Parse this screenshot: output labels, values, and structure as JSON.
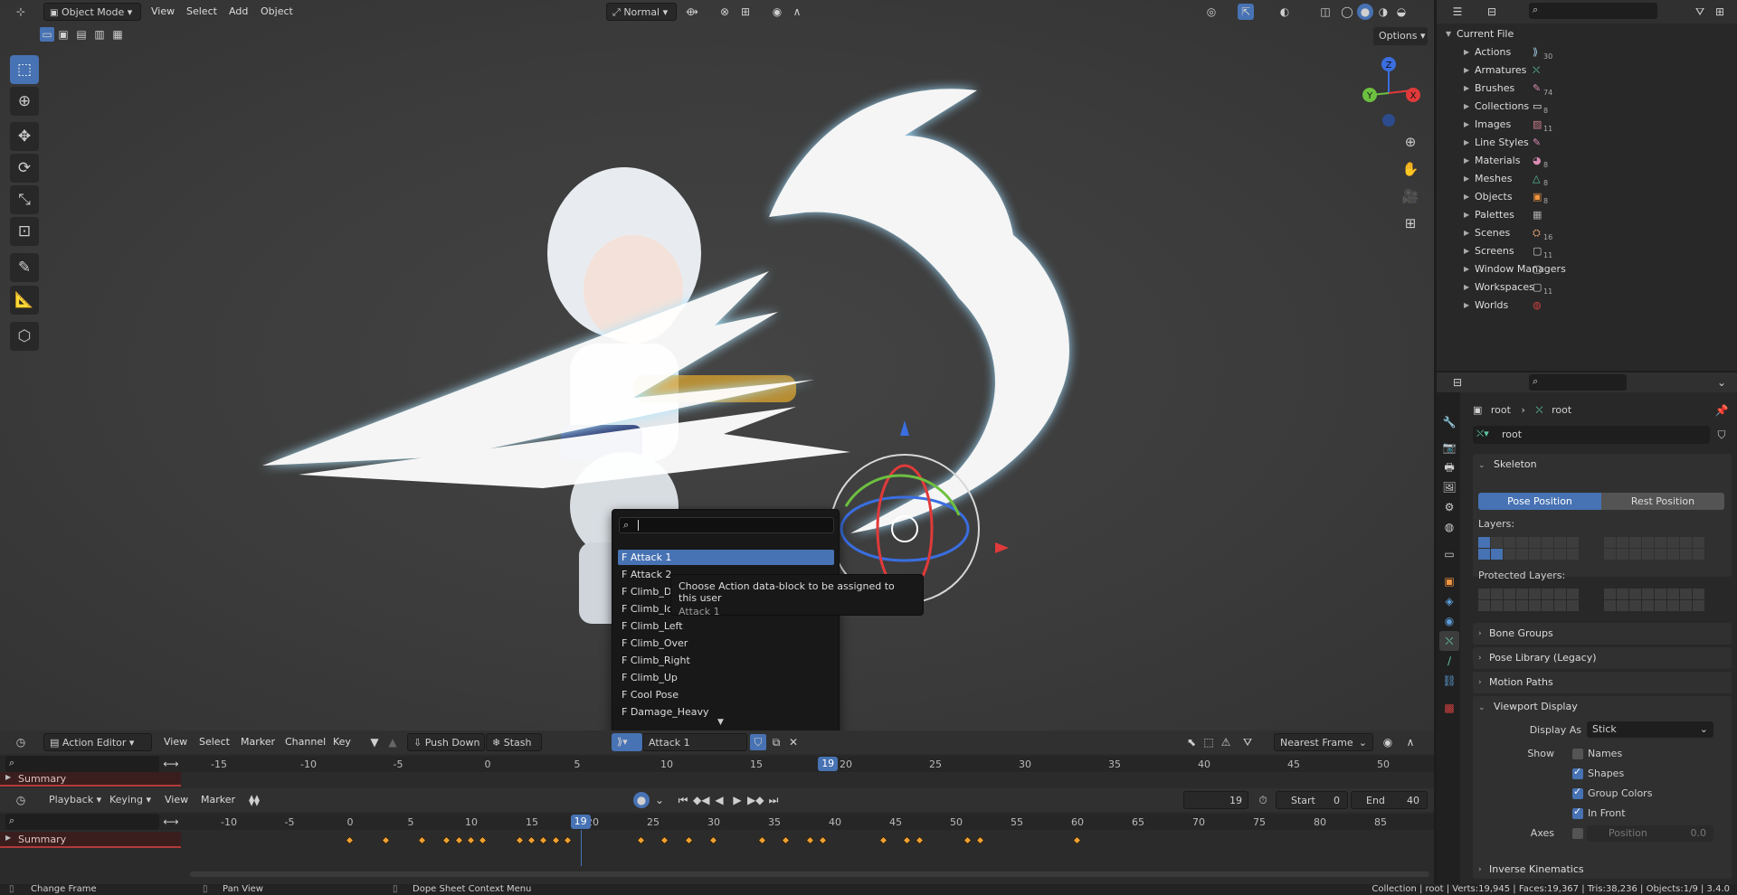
{
  "viewport": {
    "mode": "Object Mode",
    "menus": [
      "View",
      "Select",
      "Add",
      "Object"
    ],
    "orientation": "Normal",
    "options_label": "Options",
    "gizmo_axes": {
      "x": "X",
      "y": "Y",
      "z": "Z"
    }
  },
  "action_popup": {
    "search_value": "",
    "items": [
      "F Attack 1",
      "F Attack 2",
      "F Climb_D",
      "F Climb_Id",
      "F Climb_Left",
      "F Climb_Over",
      "F Climb_Right",
      "F Climb_Up",
      "F Cool Pose",
      "F Damage_Heavy"
    ],
    "selected_index": 0
  },
  "tooltip": {
    "title": "Choose Action data-block to be assigned to this user",
    "subtitle": "Attack 1"
  },
  "outliner": {
    "root": "Current File",
    "items": [
      {
        "label": "Actions",
        "count": "30"
      },
      {
        "label": "Armatures",
        "count": ""
      },
      {
        "label": "Brushes",
        "count": "74"
      },
      {
        "label": "Collections",
        "count": "8"
      },
      {
        "label": "Images",
        "count": "11"
      },
      {
        "label": "Line Styles",
        "count": ""
      },
      {
        "label": "Materials",
        "count": "8"
      },
      {
        "label": "Meshes",
        "count": "8"
      },
      {
        "label": "Objects",
        "count": "8"
      },
      {
        "label": "Palettes",
        "count": ""
      },
      {
        "label": "Scenes",
        "count": "16"
      },
      {
        "label": "Screens",
        "count": "11"
      },
      {
        "label": "Window Managers",
        "count": ""
      },
      {
        "label": "Workspaces",
        "count": "11"
      },
      {
        "label": "Worlds",
        "count": ""
      }
    ]
  },
  "properties": {
    "breadcrumb_object": "root",
    "breadcrumb_data": "root",
    "datablock_name": "root",
    "skeleton": {
      "title": "Skeleton",
      "pose_position": "Pose Position",
      "rest_position": "Rest Position",
      "layers_label": "Layers:",
      "protected_label": "Protected Layers:"
    },
    "panels": [
      "Bone Groups",
      "Pose Library (Legacy)",
      "Motion Paths"
    ],
    "viewport_display": {
      "title": "Viewport Display",
      "display_as_label": "Display As",
      "display_as_value": "Stick",
      "show_label": "Show",
      "names": {
        "label": "Names",
        "checked": false
      },
      "shapes": {
        "label": "Shapes",
        "checked": true
      },
      "group_colors": {
        "label": "Group Colors",
        "checked": true
      },
      "in_front": {
        "label": "In Front",
        "checked": true
      },
      "axes_label": "Axes",
      "position_label": "Position",
      "position_value": "0.0"
    },
    "inverse_kinematics": "Inverse Kinematics"
  },
  "action_editor": {
    "mode": "Action Editor",
    "menus": [
      "View",
      "Select",
      "Marker",
      "Channel",
      "Key"
    ],
    "push_down": "Push Down",
    "stash": "Stash",
    "action_name": "Attack 1",
    "snap": "Nearest Frame",
    "ticks": [
      "-15",
      "-10",
      "-5",
      "0",
      "5",
      "10",
      "15",
      "20",
      "25",
      "30",
      "35",
      "40",
      "45",
      "50"
    ],
    "current_frame": "19",
    "summary": "Summary"
  },
  "timeline": {
    "menus": [
      "Playback",
      "Keying",
      "View",
      "Marker"
    ],
    "current_frame": "19",
    "start_label": "Start",
    "start_value": "0",
    "end_label": "End",
    "end_value": "40",
    "ticks": [
      "-10",
      "-5",
      "0",
      "5",
      "10",
      "15",
      "20",
      "25",
      "30",
      "35",
      "40",
      "45",
      "50",
      "55",
      "60",
      "65",
      "70",
      "75",
      "80",
      "85"
    ],
    "summary": "Summary",
    "keyframes": [
      0,
      3,
      6,
      8,
      9,
      10,
      11,
      14,
      15,
      16,
      17,
      18,
      24,
      26,
      28,
      30,
      34,
      36,
      38,
      39,
      44,
      46,
      47,
      51,
      52,
      60
    ]
  },
  "statusbar": {
    "left1": "Change Frame",
    "left2": "Pan View",
    "left3": "Dope Sheet Context Menu",
    "right": "Collection | root | Verts:19,945 | Faces:19,367 | Tris:38,236 | Objects:1/9 | 3.4.0"
  }
}
